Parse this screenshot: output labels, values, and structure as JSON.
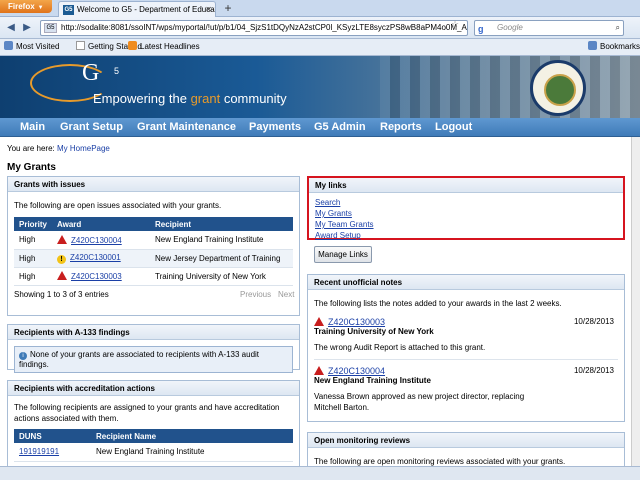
{
  "browser": {
    "menu_button": "Firefox",
    "tab_title": "Welcome to G5 - Department of Educatio...",
    "url": "http://sodalite:8081/ssoINT/wps/myportal/!ut/p/b1/04_SjzS1tDQyNzA2stCP0l_KSyzLTE8syczPS8wB8aPM4o0M_AC",
    "search_placeholder": "Google",
    "bookmarks_label": "Bookmarks",
    "bookmarks": [
      "Most Visited",
      "Getting Started",
      "Latest Headlines"
    ]
  },
  "banner": {
    "logo": "G5",
    "tagline_pre": "Empowering the ",
    "tagline_accent": "grant",
    "tagline_post": " community"
  },
  "menu": [
    "Main",
    "Grant Setup",
    "Grant Maintenance",
    "Payments",
    "G5 Admin",
    "Reports",
    "Logout"
  ],
  "breadcrumb": {
    "prefix": "You are here: ",
    "link": "My HomePage"
  },
  "page_title": "My Grants",
  "grants_with_issues": {
    "title": "Grants with issues",
    "intro": "The following are open issues associated with your grants.",
    "columns": [
      "Priority",
      "Award",
      "Recipient"
    ],
    "rows": [
      {
        "priority": "High",
        "icon": "warning-red-icon",
        "award": "Z420C130004",
        "recipient": "New England Training Institute"
      },
      {
        "priority": "High",
        "icon": "warning-yellow-icon",
        "award": "Z420C130001",
        "recipient": "New Jersey Department of Training"
      },
      {
        "priority": "High",
        "icon": "warning-red-icon",
        "award": "Z420C130003",
        "recipient": "Training University of New York"
      }
    ],
    "summary": "Showing 1 to 3 of 3 entries",
    "prev": "Previous",
    "next": "Next"
  },
  "a133": {
    "title": "Recipients with A-133 findings",
    "message": "None of your grants are associated to recipients with A-133 audit findings."
  },
  "accreditation": {
    "title": "Recipients with accreditation actions",
    "intro": "The following recipients are assigned to your grants and have accreditation actions associated with them.",
    "columns": [
      "DUNS",
      "Recipient Name"
    ],
    "rows": [
      {
        "duns": "191919191",
        "name": "New England Training Institute"
      }
    ]
  },
  "my_links": {
    "title": "My links",
    "links": [
      "Search",
      "My Grants",
      "My Team Grants",
      "Award Setup"
    ],
    "manage_button": "Manage Links"
  },
  "notes": {
    "title": "Recent unofficial notes",
    "intro": "The following lists the notes added to your awards in the last 2 weeks.",
    "items": [
      {
        "award": "Z420C130003",
        "date": "10/28/2013",
        "org": "Training University of New York",
        "text": "The wrong Audit Report is attached to this grant."
      },
      {
        "award": "Z420C130004",
        "date": "10/28/2013",
        "org": "New England Training Institute",
        "text": "Vanessa Brown approved as new project director, replacing Mitchell Barton."
      }
    ]
  },
  "monitoring": {
    "title": "Open monitoring reviews",
    "intro": "The following are open monitoring reviews associated with your grants."
  }
}
